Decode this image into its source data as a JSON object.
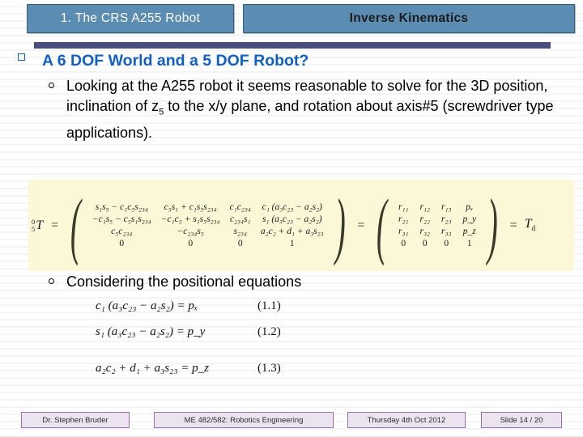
{
  "header": {
    "left_title": "1. The CRS A255 Robot",
    "right_title": "Inverse Kinematics",
    "box_color": "#5b8db3",
    "rule_color": "#4a4e7d"
  },
  "body": {
    "bullet1": "A 6 DOF World and a 5 DOF Robot?",
    "bullet1_color": "#1160c4",
    "sub1_part1": "Looking at the A255 robot it seems reasonable to solve for the 3D position, inclination of z",
    "sub1_sub": "5",
    "sub1_part2": " to the x/y plane, and rotation about axis#5 (screwdriver type applications).",
    "sub2": "Considering the positional equations"
  },
  "matrix_equation": {
    "panel_color": "#fbf8d8",
    "lhs_sup": "0",
    "lhs_sub": "5",
    "lhs_symbol": "T",
    "equals": "=",
    "equals2": "=",
    "tail": "T",
    "tail_sub": "d",
    "left_matrix": [
      [
        "s₁s₅ − c₁c₅s₂₃₄",
        "c₅s₁ + c₁s₅s₂₃₄",
        "c₁c₂₃₄",
        "c₁ (a₃c₂₃ − a₂s₂)"
      ],
      [
        "−c₁s₅ − c₅s₁s₂₃₄",
        "−c₁c₅ + s₁s₅s₂₃₄",
        "c₂₃₄s₁",
        "s₁ (a₃c₂₃ − a₂s₂)"
      ],
      [
        "c₅c₂₃₄",
        "−c₂₃₄s₅",
        "s₂₃₄",
        "a₂c₂ + d₁ + a₃s₂₃"
      ],
      [
        "0",
        "0",
        "0",
        "1"
      ]
    ],
    "right_matrix": [
      [
        "r₁₁",
        "r₁₂",
        "r₁₃",
        "pₓ"
      ],
      [
        "r₂₁",
        "r₂₂",
        "r₂₃",
        "p_y"
      ],
      [
        "r₃₁",
        "r₃₂",
        "r₃₃",
        "p_z"
      ],
      [
        "0",
        "0",
        "0",
        "1"
      ]
    ]
  },
  "equations": [
    {
      "lhs": "c₁ (a₃c₂₃ − a₂s₂) = pₓ",
      "number": "(1.1)"
    },
    {
      "lhs": "s₁ (a₃c₂₃ − a₂s₂) = p_y",
      "number": "(1.2)"
    },
    {
      "lhs": "a₂c₂ + d₁ + a₃s₂₃ = p_z",
      "number": "(1.3)"
    }
  ],
  "footer": {
    "author": "Dr. Stephen Bruder",
    "course": "ME 482/582: Robotics Engineering",
    "date": "Thursday 4th Oct 2012",
    "slide": "Slide 14 /  20",
    "box_color": "#ece3f0",
    "border_color": "#9b6fa8"
  }
}
